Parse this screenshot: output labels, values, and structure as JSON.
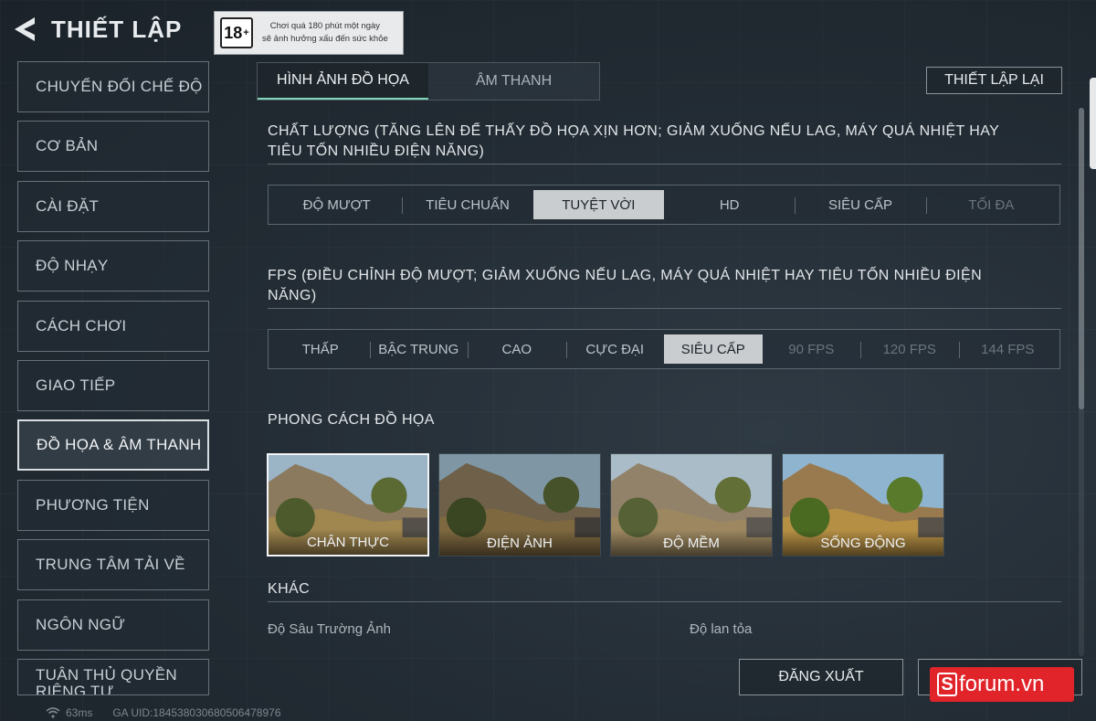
{
  "header": {
    "title": "THIẾT LẬP",
    "age_rating": "18",
    "age_rating_plus": "+",
    "age_warning_line1": "Chơi quá 180 phút một ngày",
    "age_warning_line2": "sẽ ảnh hưởng xấu đến sức khỏe"
  },
  "sidebar": {
    "items": [
      {
        "label": "CHUYỂN ĐỔI CHẾ ĐỘ"
      },
      {
        "label": "CƠ BẢN"
      },
      {
        "label": "CÀI ĐẶT"
      },
      {
        "label": "ĐỘ NHẠY"
      },
      {
        "label": "CÁCH CHƠI"
      },
      {
        "label": "GIAO TIẾP"
      },
      {
        "label": "ĐỒ HỌA & ÂM THANH"
      },
      {
        "label": "PHƯƠNG TIỆN"
      },
      {
        "label": "TRUNG TÂM TẢI VỀ"
      },
      {
        "label": "NGÔN NGỮ"
      },
      {
        "label": "TUÂN THỦ QUYỀN RIÊNG TƯ"
      }
    ],
    "active_index": 6
  },
  "tabs": [
    {
      "label": "HÌNH ẢNH ĐỒ HỌA"
    },
    {
      "label": "ÂM THANH"
    }
  ],
  "reset_label": "THIẾT LẬP LẠI",
  "quality": {
    "title": "CHẤT LƯỢNG (TĂNG LÊN ĐỂ THẤY ĐỒ HỌA XỊN HƠN; GIẢM XUỐNG NẾU LAG, MÁY QUÁ NHIỆT HAY TIÊU TỐN NHIỀU ĐIỆN NĂNG)",
    "options": [
      "ĐỘ MƯỢT",
      "TIÊU CHUẨN",
      "TUYỆT VỜI",
      "HD",
      "SIÊU CẤP",
      "TỐI ĐA"
    ],
    "selected": "TUYỆT VỜI"
  },
  "fps": {
    "title": "FPS (ĐIỀU CHỈNH ĐỘ MƯỢT; GIẢM XUỐNG NẾU LAG, MÁY QUÁ NHIỆT HAY TIÊU TỐN NHIỀU ĐIỆN NĂNG)",
    "options": [
      "THẤP",
      "BẬC TRUNG",
      "CAO",
      "CỰC ĐẠI",
      "SIÊU CẤP",
      "90 FPS",
      "120 FPS",
      "144 FPS"
    ],
    "selected": "SIÊU CẤP"
  },
  "graphics_style": {
    "title": "PHONG CÁCH ĐỒ HỌA",
    "options": [
      "CHÂN THỰC",
      "ĐIỆN ẢNH",
      "ĐỘ MỀM",
      "SỐNG ĐỘNG"
    ],
    "selected": "CHÂN THỰC"
  },
  "other": {
    "title": "KHÁC",
    "depth_of_field": "Độ Sâu Trường Ảnh",
    "bloom": "Độ lan tỏa"
  },
  "logout_label": "ĐĂNG XUẤT",
  "status": {
    "ping": "63ms",
    "uid": "GA UID:18453803068050647897​6"
  },
  "watermark": {
    "s": "S",
    "text": "forum.vn"
  },
  "icons": {
    "back": "back-arrow-icon",
    "wifi": "wifi-icon"
  }
}
